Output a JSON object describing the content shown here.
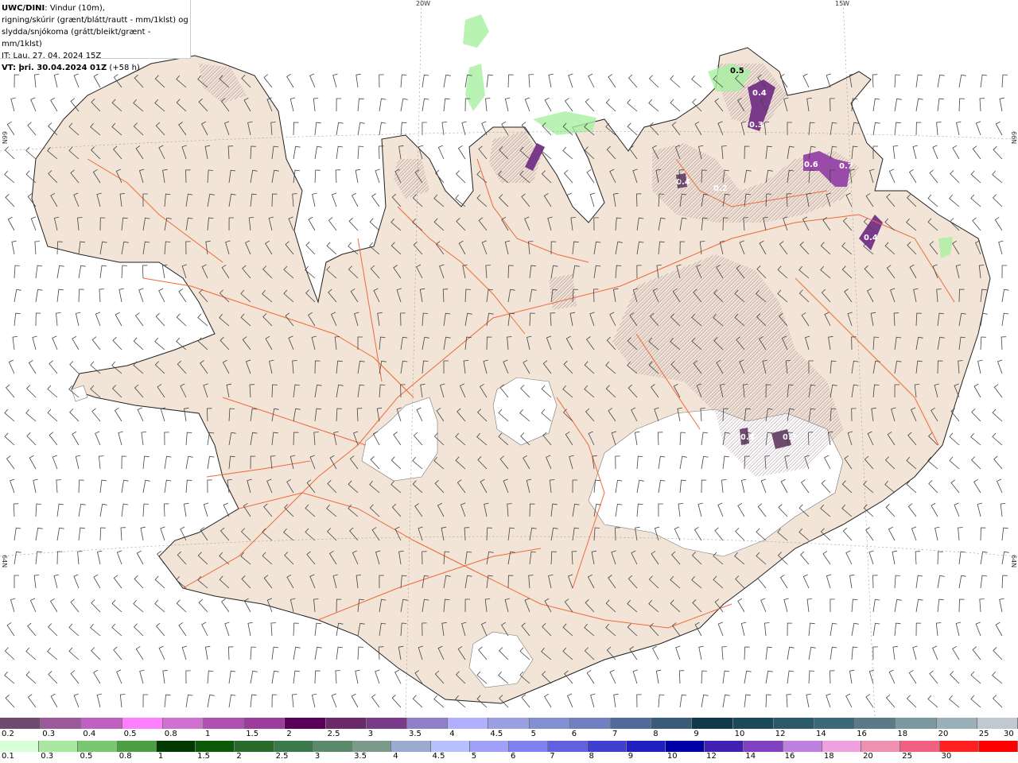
{
  "header": {
    "title_bold": "UWC/DINI",
    "title_rest": ": Vindur (10m),",
    "line2": "rigning/skúrir (grænt/blátt/rautt - mm/1klst) og",
    "line3": "slydda/snjókoma (grátt/bleikt/grænt - mm/1klst)",
    "line4": "IT: Lau. 27. 04. 2024 15Z",
    "line5_bold": "VT: þri. 30.04.2024 01Z",
    "line5_rest": " (+58 h)"
  },
  "grid_labels": {
    "lon_20w": "20W",
    "lon_15w": "15W",
    "lat_66n_left": "66N",
    "lat_66n_right": "66N",
    "lat_64n_left": "64N",
    "lat_64n_right": "64N"
  },
  "map_values": {
    "v1": "0.5",
    "v2": "0.4",
    "v3": "0.3",
    "v4": "0.6",
    "v5": "0.7",
    "v6": "0.4",
    "v7": "0.4",
    "v8": "0.3",
    "v9": "0.3",
    "v10": "0.2"
  },
  "legend_top": {
    "labels": [
      "0.2",
      "0.3",
      "0.4",
      "0.5",
      "0.8",
      "1",
      "1.5",
      "2",
      "2.5",
      "3",
      "3.5",
      "4",
      "4.5",
      "5",
      "6",
      "7",
      "8",
      "9",
      "10",
      "12",
      "14",
      "16",
      "18",
      "20",
      "25",
      "30"
    ],
    "colors": [
      "#6e4a6e",
      "#9a5a9a",
      "#c060c0",
      "#ff80ff",
      "#d070d0",
      "#b050b0",
      "#9c3c9c",
      "#5a005a",
      "#6a2a6a",
      "#7a3a8a",
      "#9080c8",
      "#b0b0ff",
      "#9aa0e0",
      "#8090d0",
      "#7080c0",
      "#506a9a",
      "#3a5a7a",
      "#103a4a",
      "#1a4a5a",
      "#2a5a6a",
      "#3a6a7a",
      "#5a7a8a",
      "#7a9aa0",
      "#9ab0b8",
      "#c0c8d0"
    ]
  },
  "legend_bottom": {
    "labels": [
      "0.1",
      "0.3",
      "0.5",
      "0.8",
      "1",
      "1.5",
      "2",
      "2.5",
      "3",
      "3.5",
      "4",
      "4.5",
      "5",
      "6",
      "7",
      "8",
      "9",
      "10",
      "12",
      "14",
      "16",
      "18",
      "20",
      "25",
      "30"
    ],
    "colors": [
      "#d8ffd8",
      "#a8e8a0",
      "#78c870",
      "#4aa040",
      "#003a00",
      "#0a5a0a",
      "#2a6a2a",
      "#3a7a4a",
      "#5a8a6a",
      "#7a9a8a",
      "#9aaad0",
      "#b8c0ff",
      "#a0a0f8",
      "#8080f0",
      "#6060e0",
      "#4040d0",
      "#2020c0",
      "#0000a8",
      "#4020b0",
      "#8040c0",
      "#c080e0",
      "#f0a0e0",
      "#f090b0",
      "#f06080",
      "#ff2020",
      "#ff0000"
    ]
  }
}
